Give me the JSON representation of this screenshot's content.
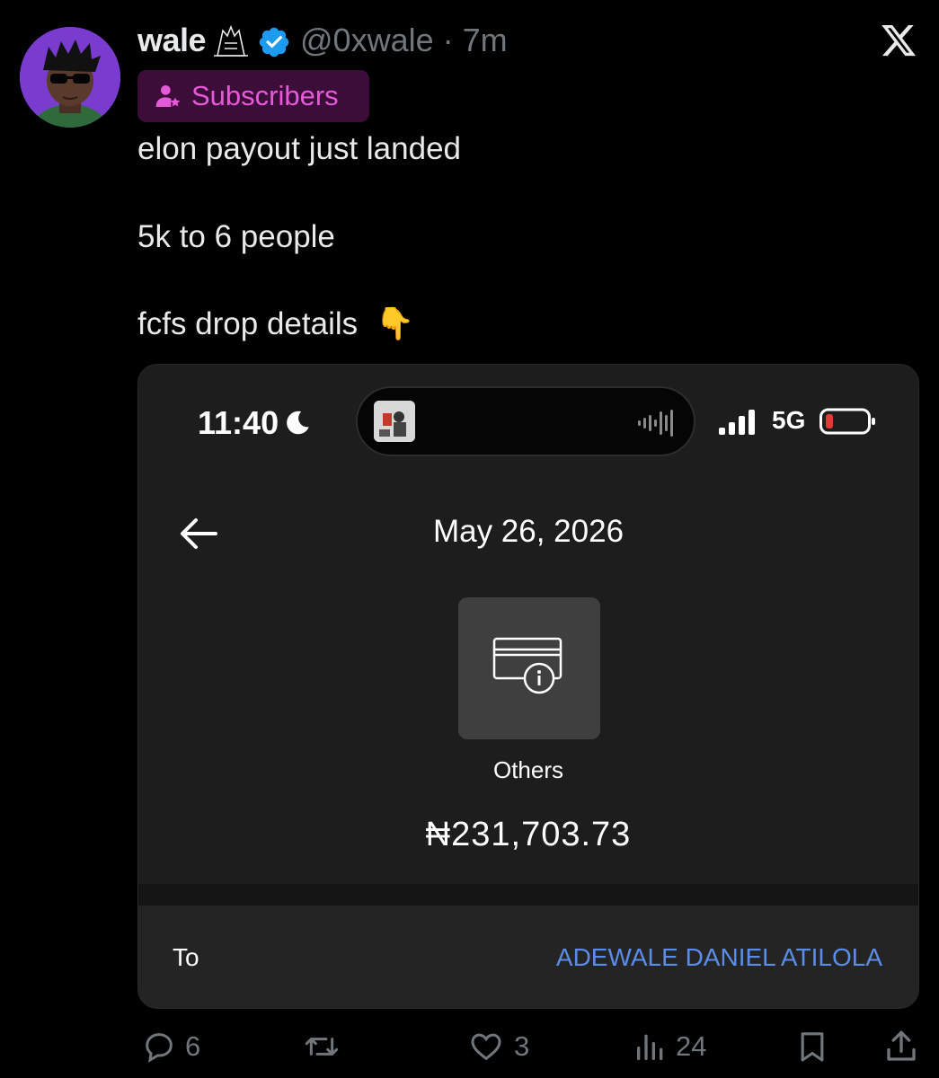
{
  "post": {
    "display_name": "wale",
    "handle": "@0xwale",
    "separator": "·",
    "time_ago": "7m",
    "subscriber_badge": "Subscribers",
    "text_lines": [
      "elon payout just landed",
      "5k to 6 people",
      "fcfs drop details"
    ],
    "emoji": "👇"
  },
  "embedded": {
    "status_time": "11:40",
    "network": "5G",
    "date": "May 26, 2026",
    "category": "Others",
    "amount": "₦231,703.73",
    "to_label": "To",
    "to_value": "ADEWALE DANIEL ATILOLA",
    "accent_color": "#5b8de8"
  },
  "actions": {
    "replies": "6",
    "reposts": "",
    "likes": "3",
    "views": "24"
  },
  "colors": {
    "background": "#000000",
    "badge_bg": "#3d0d3a",
    "badge_text": "#e45ad9",
    "verified": "#1d9bf0",
    "muted": "#71767b"
  },
  "icons": [
    "verified-badge-icon",
    "x-logo-icon",
    "subscriber-icon",
    "moon-icon",
    "signal-icon",
    "battery-icon",
    "back-arrow-icon",
    "card-info-icon",
    "reply-icon",
    "repost-icon",
    "like-icon",
    "views-icon",
    "bookmark-icon",
    "share-icon"
  ]
}
